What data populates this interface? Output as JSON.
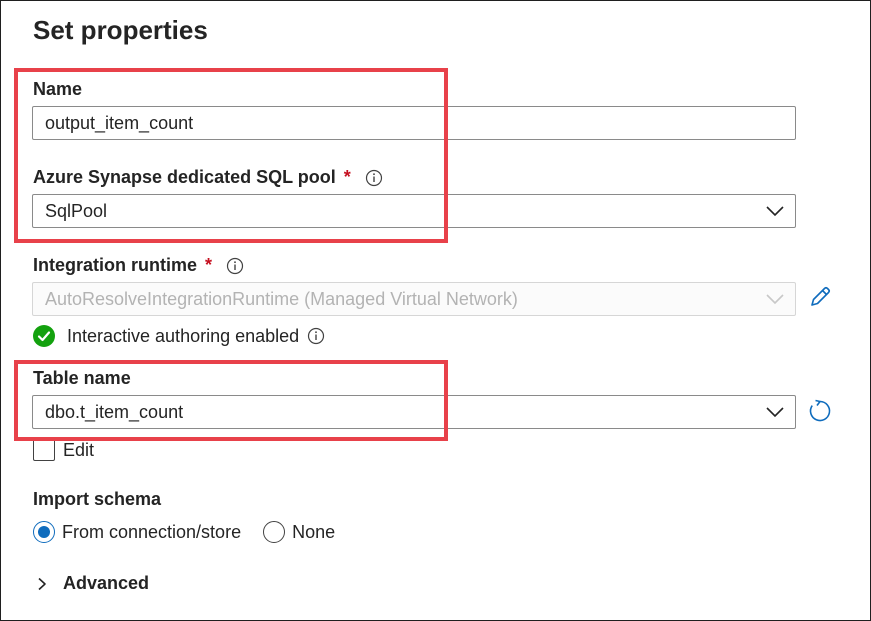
{
  "panel": {
    "title": "Set properties"
  },
  "name_field": {
    "label": "Name",
    "value": "output_item_count"
  },
  "sql_pool": {
    "label": "Azure Synapse dedicated SQL pool",
    "required_mark": "*",
    "value": "SqlPool"
  },
  "integration_runtime": {
    "label": "Integration runtime",
    "required_mark": "*",
    "value": "AutoResolveIntegrationRuntime (Managed Virtual Network)",
    "status_text": "Interactive authoring enabled"
  },
  "table_name": {
    "label": "Table name",
    "value": "dbo.t_item_count",
    "edit_label": "Edit"
  },
  "import_schema": {
    "label": "Import schema",
    "options": [
      "From connection/store",
      "None"
    ],
    "selected": "From connection/store"
  },
  "advanced": {
    "label": "Advanced"
  },
  "colors": {
    "accent": "#0f6cbd",
    "required": "#c50f1f",
    "highlight": "#e8414a",
    "success": "#13a10e"
  },
  "icons": [
    "info-icon",
    "chevron-down-icon",
    "pencil-icon",
    "check-circle-icon",
    "refresh-icon",
    "caret-right-icon"
  ]
}
